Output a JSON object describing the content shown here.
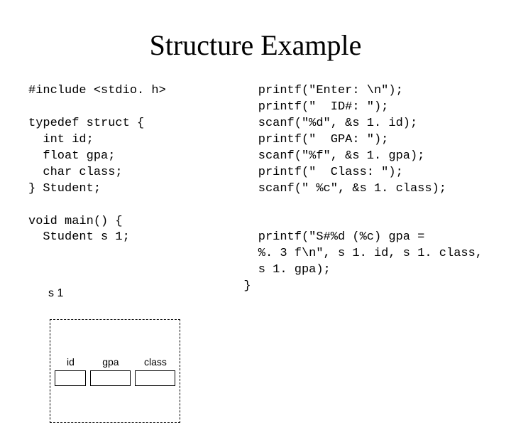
{
  "title": "Structure Example",
  "left": {
    "l1": "#include <stdio. h>",
    "l2": "",
    "l3": "typedef struct {",
    "l4": "  int id;",
    "l5": "  float gpa;",
    "l6": "  char class;",
    "l7": "} Student;",
    "l8": "",
    "l9": "void main() {",
    "l10": "  Student s 1;"
  },
  "right": {
    "r1": "  printf(\"Enter: \\n\");",
    "r2": "  printf(\"  ID#: \");",
    "r3": "  scanf(\"%d\", &s 1. id);",
    "r4": "  printf(\"  GPA: \");",
    "r5": "  scanf(\"%f\", &s 1. gpa);",
    "r6": "  printf(\"  Class: \");",
    "r7": "  scanf(\" %c\", &s 1. class);",
    "r8": "",
    "r9": "",
    "r10": "  printf(\"S#%d (%c) gpa =",
    "r11": "  %. 3 f\\n\", s 1. id, s 1. class,",
    "r12": "  s 1. gpa);",
    "r13": "}"
  },
  "diagram": {
    "var": "s 1",
    "fields": {
      "id": "id",
      "gpa": "gpa",
      "class": "class"
    }
  }
}
